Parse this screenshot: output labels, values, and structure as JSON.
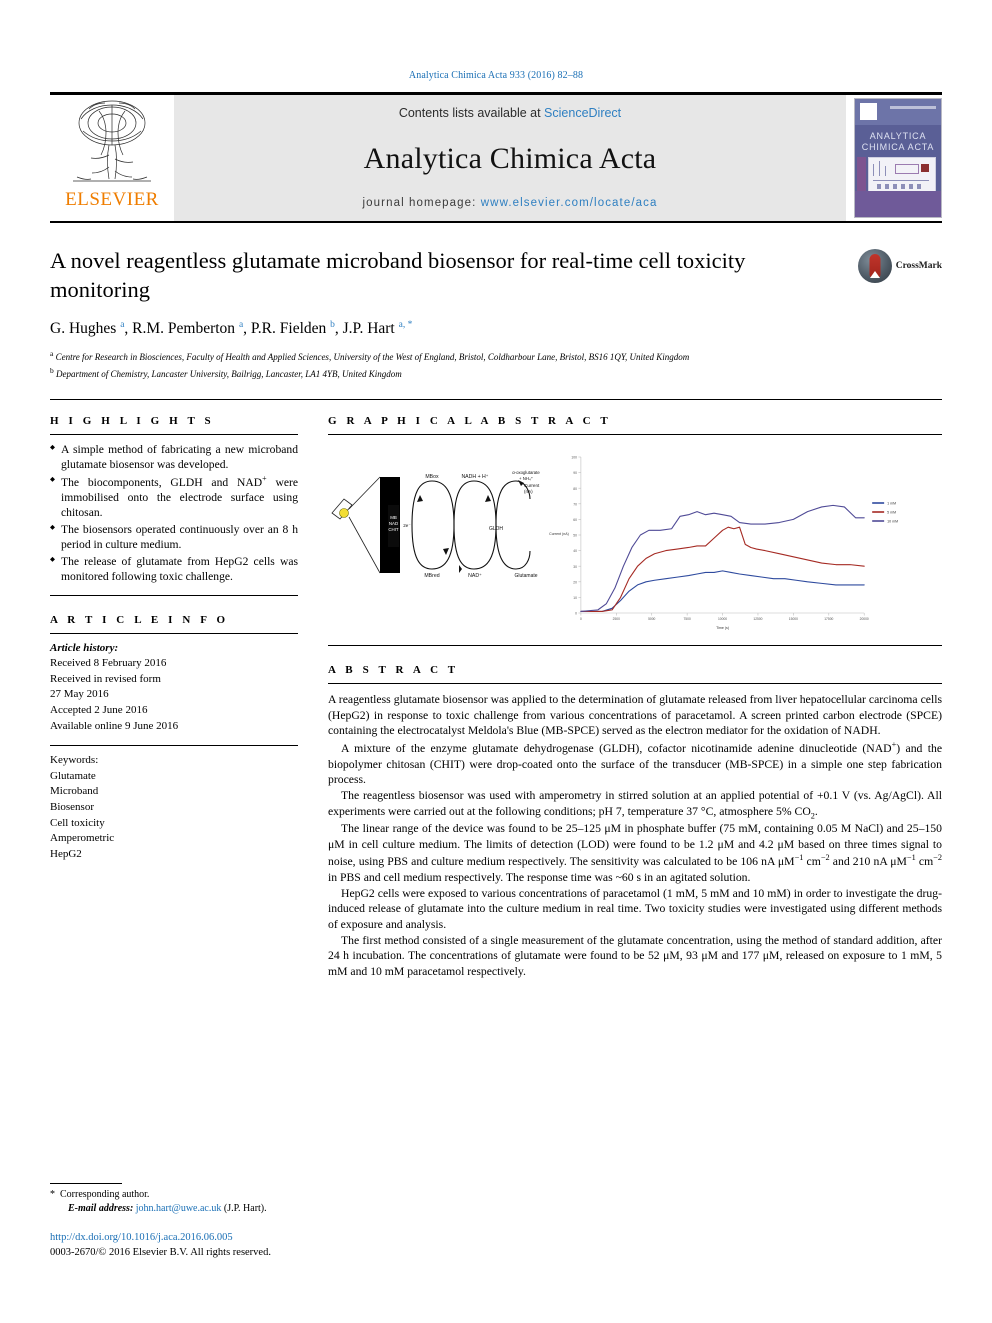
{
  "running_head": "Analytica Chimica Acta 933 (2016) 82–88",
  "masthead": {
    "contents_prefix": "Contents lists available at ",
    "sciencedirect": "ScienceDirect",
    "journal_title": "Analytica Chimica Acta",
    "homepage_prefix": "journal homepage: ",
    "homepage_url": "www.elsevier.com/locate/aca",
    "publisher": "ELSEVIER",
    "cover_title": "ANALYTICA CHIMICA ACTA",
    "logo_icon": "elsevier-tree-icon"
  },
  "article": {
    "title": "A novel reagentless glutamate microband biosensor for real-time cell toxicity monitoring",
    "crossmark_label": "CrossMark",
    "authors_html": "G. Hughes <sup>a</sup>, R.M. Pemberton <sup>a</sup>, P.R. Fielden <sup>b</sup>, J.P. Hart <sup>a, *</sup>",
    "affiliation_a": "Centre for Research in Biosciences, Faculty of Health and Applied Sciences, University of the West of England, Bristol, Coldharbour Lane, Bristol, BS16 1QY, United Kingdom",
    "affiliation_b": "Department of Chemistry, Lancaster University, Bailrigg, Lancaster, LA1 4YB, United Kingdom"
  },
  "sections": {
    "highlights": "H I G H L I G H T S",
    "graphical_abstract": "G R A P H I C A L   A B S T R A C T",
    "article_info": "A R T I C L E   I N F O",
    "abstract": "A B S T R A C T"
  },
  "highlights": [
    "A simple method of fabricating a new microband glutamate biosensor was developed.",
    "The biocomponents, GLDH and NAD<sup>+</sup> were immobilised onto the electrode surface using chitosan.",
    "The biosensors operated continuously over an 8 h period in culture medium.",
    "The release of glutamate from HepG2 cells was monitored following toxic challenge."
  ],
  "article_info": {
    "history_label": "Article history:",
    "history": [
      "Received 8 February 2016",
      "Received in revised form",
      "27 May 2016",
      "Accepted 2 June 2016",
      "Available online 9 June 2016"
    ],
    "keywords_label": "Keywords:",
    "keywords": [
      "Glutamate",
      "Microband",
      "Biosensor",
      "Cell toxicity",
      "Amperometric",
      "HepG2"
    ]
  },
  "abstract_paragraphs": [
    "A reagentless glutamate biosensor was applied to the determination of glutamate released from liver hepatocellular carcinoma cells (HepG2) in response to toxic challenge from various concentrations of paracetamol. A screen printed carbon electrode (SPCE) containing the electrocatalyst Meldola's Blue (MB-SPCE) served as the electron mediator for the oxidation of NADH.",
    "A mixture of the enzyme glutamate dehydrogenase (GLDH), cofactor nicotinamide adenine dinucleotide (NAD<sup>+</sup>) and the biopolymer chitosan (CHIT) were drop-coated onto the surface of the transducer (MB-SPCE) in a simple one step fabrication process.",
    "The reagentless biosensor was used with amperometry in stirred solution at an applied potential of +0.1 V (vs. Ag/AgCl). All experiments were carried out at the following conditions; pH 7, temperature 37 °C, atmosphere 5% CO<sub>2</sub>.",
    "The linear range of the device was found to be 25–125 μM in phosphate buffer (75 mM, containing 0.05 M NaCl) and 25–150 μM in cell culture medium. The limits of detection (LOD) were found to be 1.2 μM and 4.2 μM based on three times signal to noise, using PBS and culture medium respectively. The sensitivity was calculated to be 106 nA μM<sup>−1</sup> cm<sup>−2</sup> and 210 nA μM<sup>−1</sup> cm<sup>−2</sup> in PBS and cell medium respectively. The response time was ~60 s in an agitated solution.",
    "HepG2 cells were exposed to various concentrations of paracetamol (1 mM, 5 mM and 10 mM) in order to investigate the drug-induced release of glutamate into the culture medium in real time. Two toxicity studies were investigated using different methods of exposure and analysis.",
    "The first method consisted of a single measurement of the glutamate concentration, using the method of standard addition, after 24 h incubation. The concentrations of glutamate were found to be 52 μM, 93 μM and 177 μM, released on exposure to 1 mM, 5 mM and 10 mM paracetamol respectively."
  ],
  "schematic": {
    "electrode_label": "MB\nNAD\nCHIT",
    "electron_label": "2e−",
    "species": {
      "mb_ox": "MBox",
      "mb_red": "MBred",
      "nadh": "NADH + H⁺",
      "nad": "NAD⁺",
      "product": "α-oxoglutarate + NH₄⁺",
      "substrate": "Glutamate",
      "enzyme": "GLDH"
    },
    "current_label": "Current (nA)"
  },
  "chart_data": {
    "type": "line",
    "title": "",
    "xlabel": "Time (s)",
    "ylabel": "Current (nA)",
    "xlim": [
      0,
      20000
    ],
    "ylim": [
      0,
      100
    ],
    "xticks": [
      0,
      2500,
      5000,
      7500,
      10000,
      12500,
      15000,
      17500,
      20000
    ],
    "yticks": [
      0,
      10,
      20,
      30,
      40,
      50,
      60,
      70,
      80,
      90,
      100
    ],
    "grid": false,
    "legend_position": "right",
    "series": [
      {
        "name": "1 mM",
        "color": "#2e4a9e",
        "x": [
          0,
          1500,
          2200,
          2800,
          3400,
          4000,
          4600,
          5200,
          6000,
          6800,
          7600,
          8200,
          8800,
          9400,
          10000,
          10600,
          11200,
          12000,
          12800,
          13600,
          14400,
          15200,
          16000,
          17000,
          18000,
          19000,
          20000
        ],
        "y": [
          1,
          1,
          3,
          8,
          14,
          18,
          20,
          21,
          22,
          23,
          24,
          25,
          26,
          26,
          27,
          26,
          25,
          24,
          23,
          22,
          22,
          21,
          20,
          19,
          18,
          18,
          18
        ]
      },
      {
        "name": "5 mM",
        "color": "#a52a23",
        "x": [
          0,
          1500,
          2200,
          2800,
          3400,
          4000,
          4600,
          5200,
          6000,
          6800,
          7600,
          8200,
          8800,
          9400,
          10000,
          10400,
          10800,
          11200,
          11600,
          12000,
          12400,
          13000,
          14000,
          15000,
          16000,
          17000,
          18000,
          19000,
          20000
        ],
        "y": [
          1,
          1,
          2,
          10,
          22,
          30,
          35,
          38,
          40,
          41,
          42,
          43,
          43,
          48,
          53,
          55,
          54,
          55,
          44,
          42,
          41,
          40,
          38,
          36,
          34,
          32,
          31,
          31,
          30
        ]
      },
      {
        "name": "10 mM",
        "color": "#4f4a96",
        "x": [
          0,
          1200,
          1800,
          2400,
          3000,
          3600,
          4200,
          4800,
          5600,
          6400,
          7000,
          7600,
          8200,
          8800,
          9400,
          10000,
          10600,
          11200,
          12000,
          13000,
          14000,
          15000,
          16000,
          17000,
          17800,
          18600,
          19400,
          20000
        ],
        "y": [
          1,
          2,
          6,
          16,
          30,
          42,
          50,
          53,
          53,
          54,
          62,
          63,
          65,
          63,
          64,
          63,
          62,
          58,
          57,
          57,
          58,
          60,
          65,
          68,
          69,
          68,
          61,
          61
        ]
      }
    ]
  },
  "footer": {
    "corresponding_star": "*",
    "corresponding": "Corresponding author.",
    "email_label": "E-mail address:",
    "email": "john.hart@uwe.ac.uk",
    "email_suffix": "(J.P. Hart).",
    "doi": "http://dx.doi.org/10.1016/j.aca.2016.06.005",
    "copyright": "0003-2670/© 2016 Elsevier B.V. All rights reserved."
  }
}
